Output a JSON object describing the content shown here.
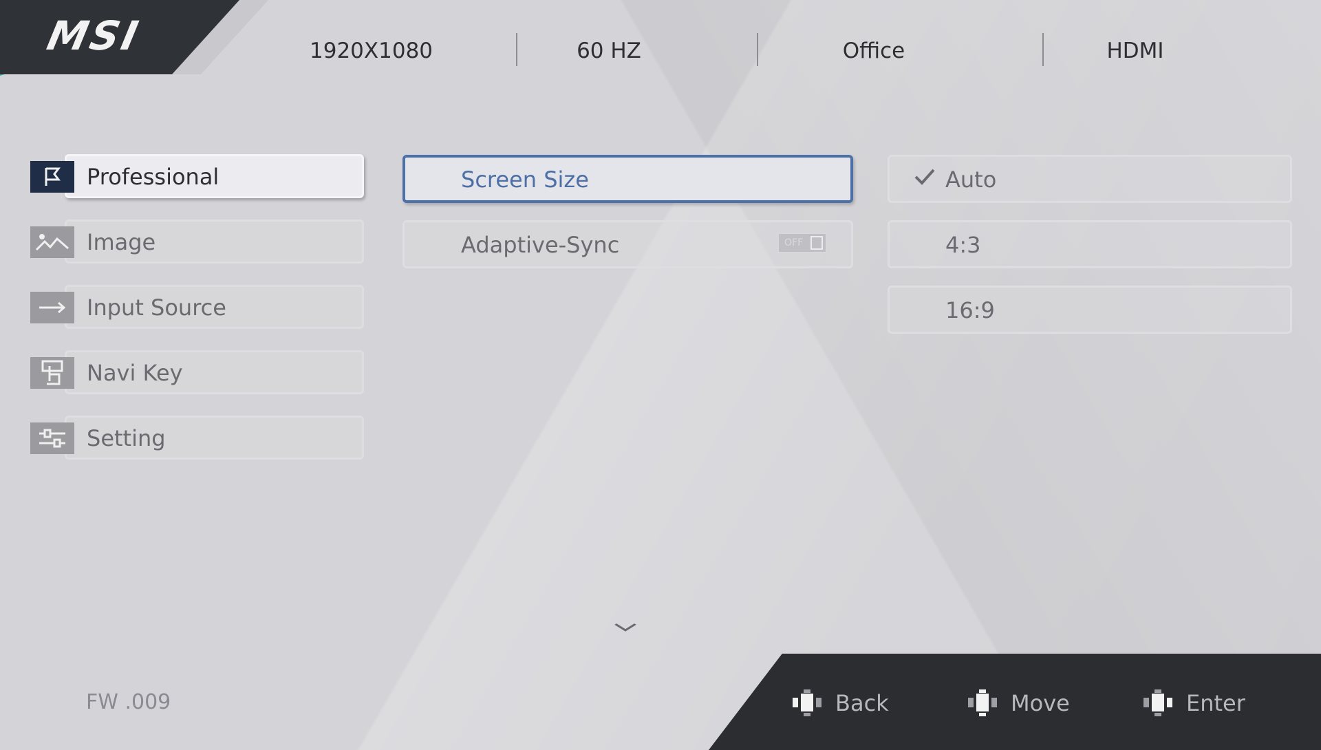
{
  "brand": {
    "logo": "MSI"
  },
  "status": {
    "resolution": "1920X1080",
    "refresh_rate": "60  HZ",
    "mode": "Office",
    "input": "HDMI"
  },
  "nav": {
    "items": [
      {
        "label": "Professional",
        "icon": "flag-icon",
        "active": true
      },
      {
        "label": "Image",
        "icon": "image-icon",
        "active": false
      },
      {
        "label": "Input Source",
        "icon": "arrow-right-icon",
        "active": false
      },
      {
        "label": "Navi Key",
        "icon": "joystick-hand-icon",
        "active": false
      },
      {
        "label": "Setting",
        "icon": "sliders-icon",
        "active": false
      }
    ]
  },
  "options": {
    "items": [
      {
        "label": "Screen Size",
        "active": true
      },
      {
        "label": "Adaptive-Sync",
        "active": false,
        "toggle": "OFF"
      }
    ],
    "more_indicator": "chevron-down-icon"
  },
  "values": {
    "items": [
      {
        "label": "Auto",
        "selected": true
      },
      {
        "label": "4:3",
        "selected": false
      },
      {
        "label": "16:9",
        "selected": false
      }
    ]
  },
  "footer": {
    "firmware": "FW .009",
    "back_label": "Back",
    "move_label": "Move",
    "enter_label": "Enter"
  },
  "colors": {
    "accent": "#4d70a8",
    "panel": "#d4d4d8",
    "dark": "#2b2d30",
    "teal": "#2aa7a0"
  }
}
